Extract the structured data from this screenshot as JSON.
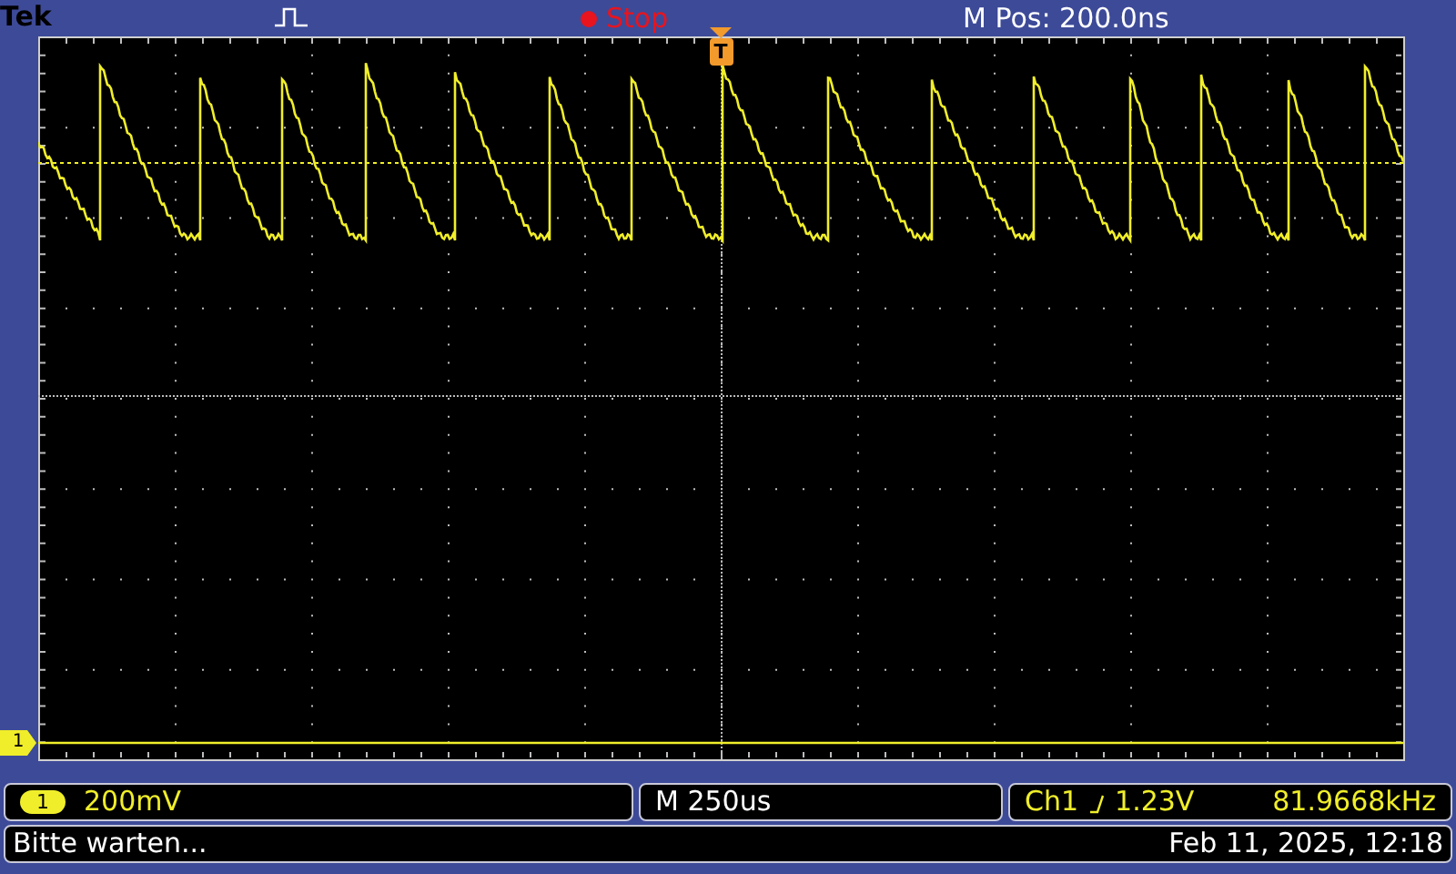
{
  "header": {
    "brand": "Tek",
    "acquisition_state": "Stop",
    "position": "M Pos: 200.0ns"
  },
  "display": {
    "trigger_marker": "T",
    "channel_marker": "1"
  },
  "readouts": {
    "channel": {
      "number": "1",
      "scale": "200mV"
    },
    "timebase": "M 250us",
    "trigger": {
      "source": "Ch1",
      "level": "1.23V",
      "frequency": "81.9668kHz"
    }
  },
  "status_bar": {
    "message": "Bitte warten...",
    "datetime": "Feb 11, 2025, 12:18"
  }
}
